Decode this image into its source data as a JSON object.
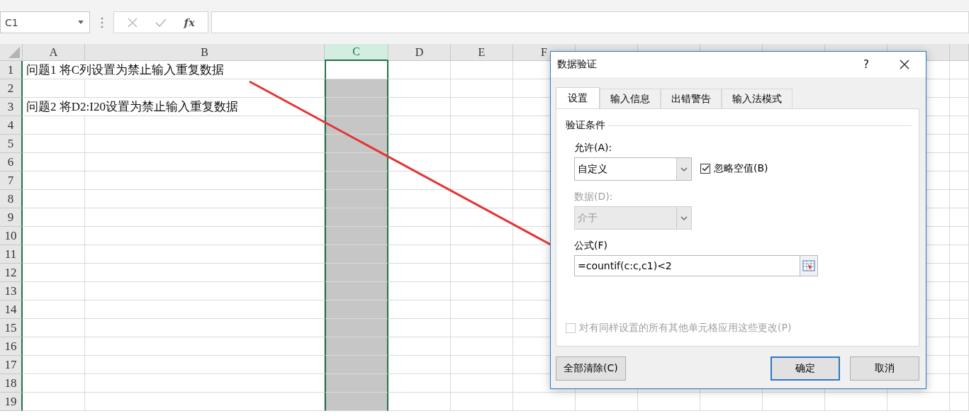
{
  "name_box": {
    "value": "C1"
  },
  "formula_bar": {
    "function_label": "fx"
  },
  "sheet": {
    "columns": [
      {
        "label": "A",
        "selected": false
      },
      {
        "label": "B",
        "selected": false
      },
      {
        "label": "C",
        "selected": true
      },
      {
        "label": "D",
        "selected": false
      },
      {
        "label": "E",
        "selected": false
      },
      {
        "label": "F",
        "selected": false
      }
    ],
    "rows": [
      {
        "number": "1",
        "text": "问题1 将C列设置为禁止输入重复数据"
      },
      {
        "number": "2"
      },
      {
        "number": "3",
        "text": "问题2 将D2:I20设置为禁止输入重复数据"
      },
      {
        "number": "4"
      },
      {
        "number": "5"
      },
      {
        "number": "6"
      },
      {
        "number": "7"
      },
      {
        "number": "8"
      },
      {
        "number": "9"
      },
      {
        "number": "10"
      },
      {
        "number": "11"
      },
      {
        "number": "12"
      },
      {
        "number": "13"
      },
      {
        "number": "14"
      },
      {
        "number": "15"
      },
      {
        "number": "16"
      },
      {
        "number": "17"
      },
      {
        "number": "18"
      },
      {
        "number": "19"
      }
    ]
  },
  "dialog": {
    "title": "数据验证",
    "help": "?",
    "tabs": [
      {
        "label": "设置",
        "selected": true
      },
      {
        "label": "输入信息",
        "selected": false
      },
      {
        "label": "出错警告",
        "selected": false
      },
      {
        "label": "输入法模式",
        "selected": false
      }
    ],
    "section": "验证条件",
    "allow": {
      "label": "允许(A):",
      "value": "自定义",
      "disabled": false
    },
    "ignore_blank": {
      "label": "忽略空值(B)",
      "checked": true
    },
    "data": {
      "label": "数据(D):",
      "value": "介于",
      "disabled": true
    },
    "formula": {
      "label": "公式(F)",
      "value": "=countif(c:c,c1)<2"
    },
    "apply_all": {
      "label": "对有同样设置的所有其他单元格应用这些更改(P)",
      "checked": false,
      "disabled": true
    },
    "buttons": [
      {
        "label": "全部清除(C)",
        "kind": "left",
        "default": false
      },
      {
        "label": "确定",
        "kind": "right",
        "default": true
      },
      {
        "label": "取消",
        "kind": "right",
        "default": false
      }
    ]
  }
}
